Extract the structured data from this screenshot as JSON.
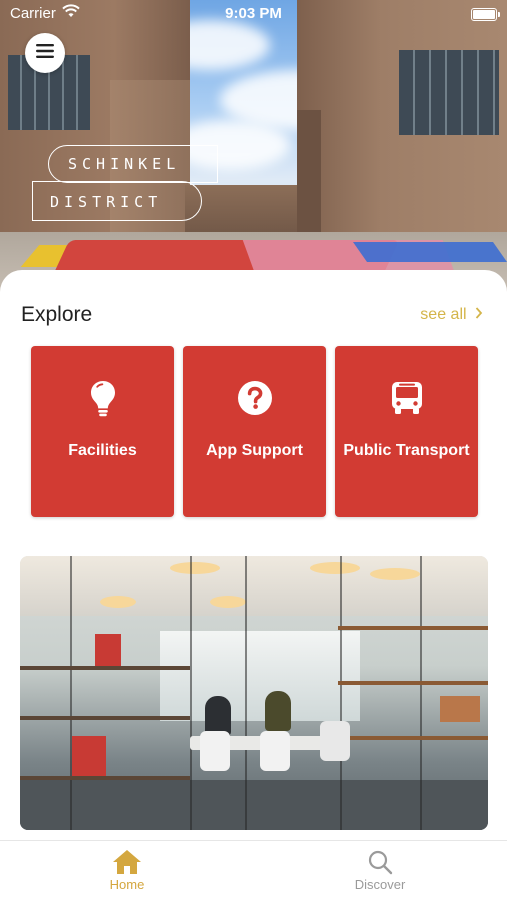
{
  "status_bar": {
    "carrier": "Carrier",
    "time": "9:03 PM"
  },
  "hero": {
    "logo_line1": "SCHINKEL",
    "logo_line2": "DISTRICT"
  },
  "explore": {
    "title": "Explore",
    "see_all": "see all",
    "cards": [
      {
        "label": "Facilities",
        "icon": "lightbulb-icon"
      },
      {
        "label": "App Support",
        "icon": "question-circle-icon"
      },
      {
        "label": "Public Transport",
        "icon": "bus-icon"
      }
    ],
    "card_color": "#d23b33"
  },
  "tabbar": {
    "home_label": "Home",
    "discover_label": "Discover",
    "active_color": "#d4a73f",
    "inactive_color": "#9a9a9a"
  },
  "accent": {
    "see_all_color": "#d4b54a"
  }
}
